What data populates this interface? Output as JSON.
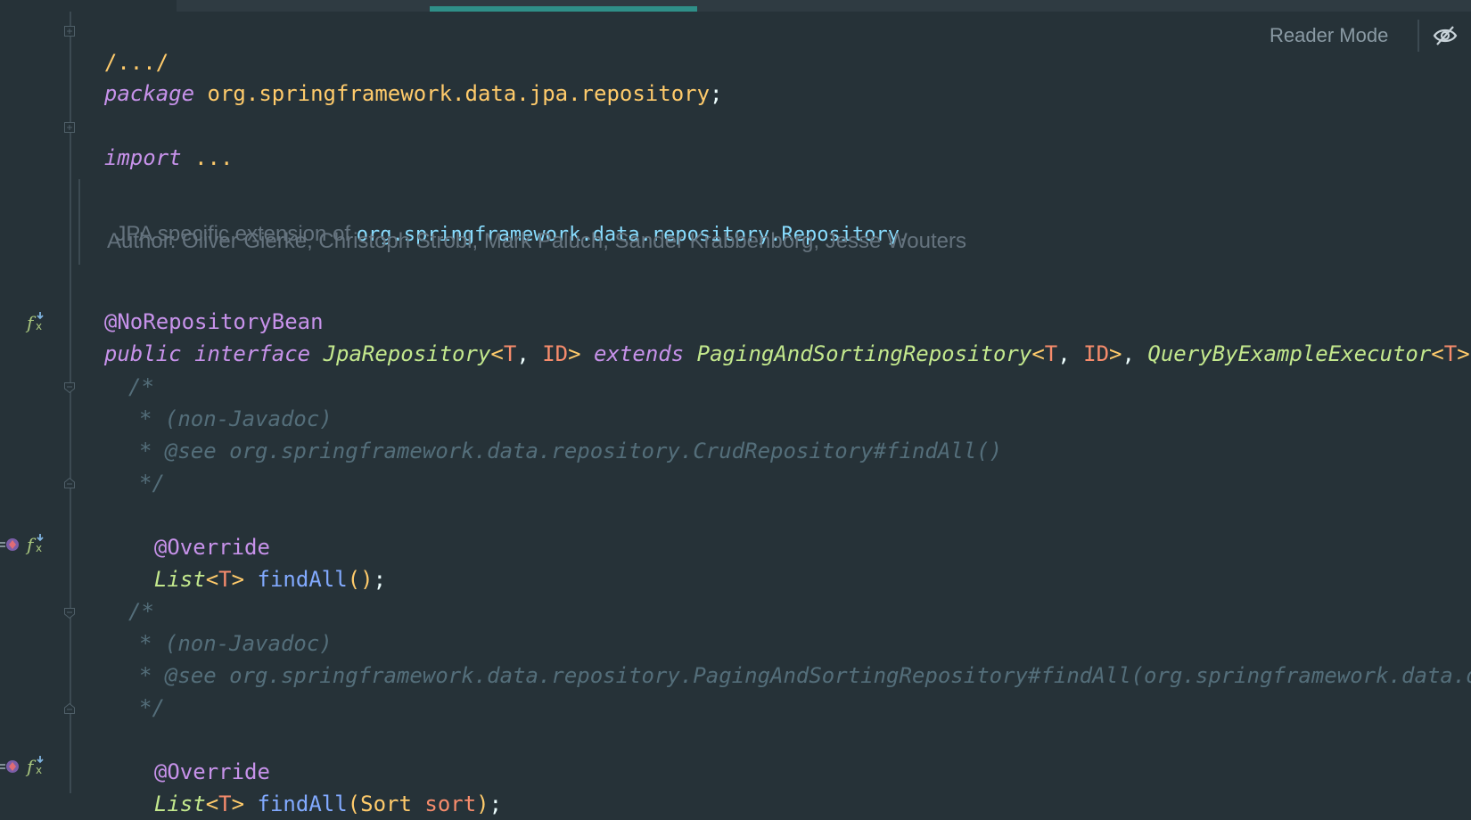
{
  "reader_mode": {
    "label": "Reader Mode"
  },
  "code": {
    "header_fold": "/.../",
    "package_kw": "package",
    "package_name": "org.springframework.data.jpa.repository",
    "semicolon": ";",
    "import_kw": "import",
    "import_dots": "...",
    "doc_desc_prefix": "JPA specific extension of ",
    "doc_desc_link": "org.springframework.data.repository.Repository",
    "doc_desc_suffix": ".",
    "doc_author": "Author: Oliver Gierke, Christoph Strobl, Mark Paluch, Sander Krabbenborg, Jesse Wouters",
    "annotation_norepo": "@NoRepositoryBean",
    "kw_public": "public",
    "kw_interface": "interface",
    "iface_name": "JpaRepository",
    "lt": "<",
    "gt": ">",
    "comma": ", ",
    "type_T": "T",
    "type_ID": "ID",
    "kw_extends": "extends",
    "super1": "PagingAndSortingRepository",
    "super2": "QueryByExampleExecutor",
    "open_brace": "{",
    "c1_open": "/*",
    "c1_line1": "* (non-Javadoc)",
    "c1_line2": "* @see org.springframework.data.repository.CrudRepository#findAll()",
    "c1_close": "*/",
    "override": "@Override",
    "list_type": "List",
    "find_all": "findAll",
    "parens_empty": "()",
    "c2_open": "/*",
    "c2_line1": "* (non-Javadoc)",
    "c2_line2": "* @see org.springframework.data.repository.PagingAndSortingRepository#findAll(org.springframework.data.domai",
    "c2_close": "*/",
    "paren_open": "(",
    "paren_close": ")",
    "sort_type": "Sort",
    "sort_param": "sort"
  },
  "gutter": {
    "icon_names": [
      "implemented-icon",
      "overrides-icon",
      "implemented-icon"
    ]
  },
  "colors": {
    "background": "#263238",
    "keyword": "#c792ea",
    "class": "#c3e88d",
    "type_param": "#f78c6c",
    "package": "#ffcb6b",
    "function": "#82aaff",
    "comment": "#546e7a",
    "active_tab": "#2f8f88"
  }
}
